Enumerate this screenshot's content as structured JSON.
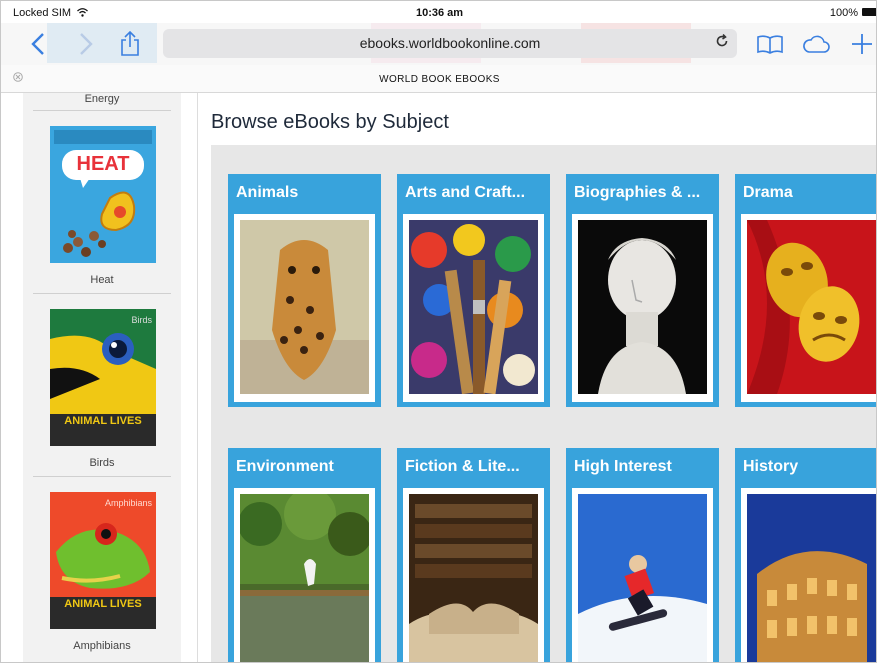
{
  "status_bar": {
    "carrier": "Locked SIM",
    "time": "10:36 am",
    "battery": "100%"
  },
  "browser": {
    "url": "ebooks.worldbookonline.com",
    "tab_title": "WORLD BOOK EBOOKS",
    "icons": [
      "back-icon",
      "forward-icon",
      "share-icon",
      "reload-icon",
      "bookmarks-icon",
      "cloud-tabs-icon",
      "new-tab-icon",
      "close-tab-icon"
    ]
  },
  "sidebar": {
    "top_label": "Energy",
    "items": [
      {
        "label": "Heat",
        "cover_title": "HEAT"
      },
      {
        "label": "Birds",
        "cover_title": "ANIMAL LIVES",
        "cover_corner": "Birds"
      },
      {
        "label": "Amphibians",
        "cover_title": "ANIMAL LIVES",
        "cover_corner": "Amphibians"
      }
    ]
  },
  "main": {
    "title": "Browse eBooks by Subject",
    "subjects": [
      {
        "label": "Animals"
      },
      {
        "label": "Arts and Craft..."
      },
      {
        "label": "Biographies & ..."
      },
      {
        "label": "Drama"
      },
      {
        "label": "Environment"
      },
      {
        "label": "Fiction & Lite..."
      },
      {
        "label": "High Interest"
      },
      {
        "label": "History"
      }
    ]
  },
  "colors": {
    "accent": "#38a3dc",
    "browser_blue": "#3a7fe0",
    "grid_bg": "#e7e7e7"
  }
}
